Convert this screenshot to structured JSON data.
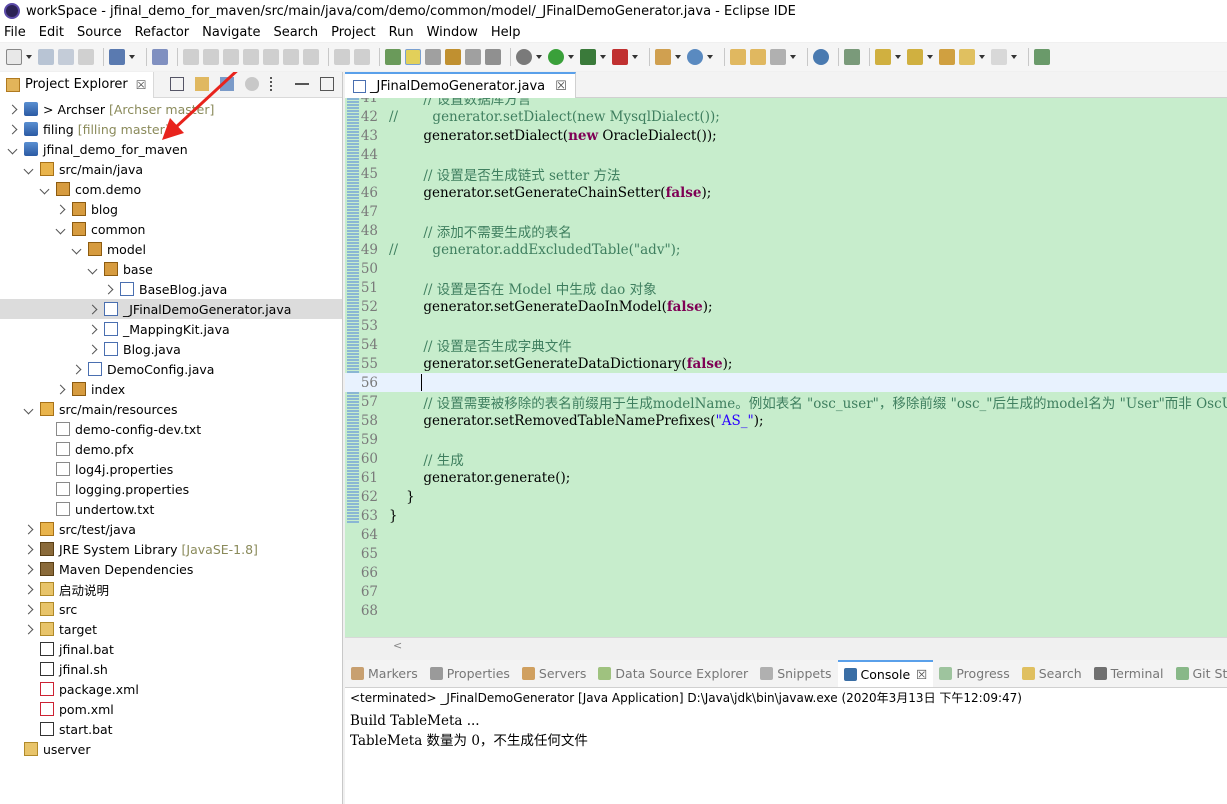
{
  "window": {
    "title": "workSpace - jfinal_demo_for_maven/src/main/java/com/demo/common/model/_JFinalDemoGenerator.java - Eclipse IDE"
  },
  "menu": [
    "File",
    "Edit",
    "Source",
    "Refactor",
    "Navigate",
    "Search",
    "Project",
    "Run",
    "Window",
    "Help"
  ],
  "explorer": {
    "tab_label": "Project Explorer",
    "close_glyph": "☒",
    "items": [
      {
        "label": "> Archser",
        "extra": "[Archser master]",
        "icon": "proj",
        "twisty": "closed",
        "depth": 0
      },
      {
        "label": "filing",
        "extra": "[filling master]",
        "icon": "proj",
        "twisty": "closed",
        "depth": 0
      },
      {
        "label": "jfinal_demo_for_maven",
        "extra": "",
        "icon": "proj",
        "twisty": "open",
        "depth": 0
      },
      {
        "label": "src/main/java",
        "extra": "",
        "icon": "pkgroot",
        "twisty": "open",
        "depth": 1
      },
      {
        "label": "com.demo",
        "extra": "",
        "icon": "pkg",
        "twisty": "open",
        "depth": 2
      },
      {
        "label": "blog",
        "extra": "",
        "icon": "pkg",
        "twisty": "closed",
        "depth": 3
      },
      {
        "label": "common",
        "extra": "",
        "icon": "pkg",
        "twisty": "open",
        "depth": 3
      },
      {
        "label": "model",
        "extra": "",
        "icon": "pkg",
        "twisty": "open",
        "depth": 4
      },
      {
        "label": "base",
        "extra": "",
        "icon": "pkg",
        "twisty": "open",
        "depth": 5
      },
      {
        "label": "BaseBlog.java",
        "extra": "",
        "icon": "java",
        "twisty": "closed",
        "depth": 6
      },
      {
        "label": "_JFinalDemoGenerator.java",
        "extra": "",
        "icon": "java",
        "twisty": "closed",
        "depth": 5,
        "selected": true
      },
      {
        "label": "_MappingKit.java",
        "extra": "",
        "icon": "java",
        "twisty": "closed",
        "depth": 5
      },
      {
        "label": "Blog.java",
        "extra": "",
        "icon": "java",
        "twisty": "closed",
        "depth": 5
      },
      {
        "label": "DemoConfig.java",
        "extra": "",
        "icon": "java",
        "twisty": "closed",
        "depth": 4
      },
      {
        "label": "index",
        "extra": "",
        "icon": "pkg",
        "twisty": "closed",
        "depth": 3
      },
      {
        "label": "src/main/resources",
        "extra": "",
        "icon": "pkgroot",
        "twisty": "open",
        "depth": 1
      },
      {
        "label": "demo-config-dev.txt",
        "extra": "",
        "icon": "file",
        "twisty": "none",
        "depth": 2
      },
      {
        "label": "demo.pfx",
        "extra": "",
        "icon": "file",
        "twisty": "none",
        "depth": 2
      },
      {
        "label": "log4j.properties",
        "extra": "",
        "icon": "file",
        "twisty": "none",
        "depth": 2
      },
      {
        "label": "logging.properties",
        "extra": "",
        "icon": "file",
        "twisty": "none",
        "depth": 2
      },
      {
        "label": "undertow.txt",
        "extra": "",
        "icon": "file",
        "twisty": "none",
        "depth": 2
      },
      {
        "label": "src/test/java",
        "extra": "",
        "icon": "pkgroot",
        "twisty": "closed",
        "depth": 1
      },
      {
        "label": "JRE System Library",
        "extra": "[JavaSE-1.8]",
        "icon": "lib",
        "twisty": "closed",
        "depth": 1
      },
      {
        "label": "Maven Dependencies",
        "extra": "",
        "icon": "lib",
        "twisty": "closed",
        "depth": 1
      },
      {
        "label": "启动说明",
        "extra": "",
        "icon": "folder",
        "twisty": "closed",
        "depth": 1
      },
      {
        "label": "src",
        "extra": "",
        "icon": "folder",
        "twisty": "closed",
        "depth": 1
      },
      {
        "label": "target",
        "extra": "",
        "icon": "folder",
        "twisty": "closed",
        "depth": 1
      },
      {
        "label": "jfinal.bat",
        "extra": "",
        "icon": "bat",
        "twisty": "none",
        "depth": 1
      },
      {
        "label": "jfinal.sh",
        "extra": "",
        "icon": "bat",
        "twisty": "none",
        "depth": 1
      },
      {
        "label": "package.xml",
        "extra": "",
        "icon": "xml",
        "twisty": "none",
        "depth": 1
      },
      {
        "label": "pom.xml",
        "extra": "",
        "icon": "xml",
        "twisty": "none",
        "depth": 1
      },
      {
        "label": "start.bat",
        "extra": "",
        "icon": "bat",
        "twisty": "none",
        "depth": 1
      },
      {
        "label": "userver",
        "extra": "",
        "icon": "folder",
        "twisty": "none",
        "depth": 0
      }
    ]
  },
  "editor": {
    "tab_label": "_JFinalDemoGenerator.java",
    "close_glyph": "☒",
    "lines": [
      {
        "n": "41",
        "t": "        // 设置数据库方言",
        "c": "cmt"
      },
      {
        "n": "42",
        "t": "//        generator.setDialect(new MysqlDialect());",
        "c": "cmt"
      },
      {
        "n": "43",
        "t": "        generator.setDialect(new OracleDialect());",
        "c": "code"
      },
      {
        "n": "44",
        "t": "",
        "c": "code"
      },
      {
        "n": "45",
        "t": "        // 设置是否生成链式 setter 方法",
        "c": "cmt"
      },
      {
        "n": "46",
        "t": "        generator.setGenerateChainSetter(false);",
        "c": "code"
      },
      {
        "n": "47",
        "t": "",
        "c": "code"
      },
      {
        "n": "48",
        "t": "        // 添加不需要生成的表名",
        "c": "cmt"
      },
      {
        "n": "49",
        "t": "//        generator.addExcludedTable(\"adv\");",
        "c": "cmt"
      },
      {
        "n": "50",
        "t": "",
        "c": "code"
      },
      {
        "n": "51",
        "t": "        // 设置是否在 Model 中生成 dao 对象",
        "c": "cmt"
      },
      {
        "n": "52",
        "t": "        generator.setGenerateDaoInModel(false);",
        "c": "code"
      },
      {
        "n": "53",
        "t": "",
        "c": "code"
      },
      {
        "n": "54",
        "t": "        // 设置是否生成字典文件",
        "c": "cmt"
      },
      {
        "n": "55",
        "t": "        generator.setGenerateDataDictionary(false);",
        "c": "code"
      },
      {
        "n": "56",
        "t": "",
        "c": "cur"
      },
      {
        "n": "57",
        "t": "        // 设置需要被移除的表名前缀用于生成modelName。例如表名 \"osc_user\"，移除前缀 \"osc_\"后生成的model名为 \"User\"而非 OscUser",
        "c": "cmt"
      },
      {
        "n": "58",
        "t": "        generator.setRemovedTableNamePrefixes(\"AS_\");",
        "c": "code"
      },
      {
        "n": "59",
        "t": "",
        "c": "code"
      },
      {
        "n": "60",
        "t": "        // 生成",
        "c": "cmt"
      },
      {
        "n": "61",
        "t": "        generator.generate();",
        "c": "code"
      },
      {
        "n": "62",
        "t": "    }",
        "c": "code"
      },
      {
        "n": "63",
        "t": "}",
        "c": "code"
      },
      {
        "n": "64",
        "t": "",
        "c": "code"
      },
      {
        "n": "65",
        "t": "",
        "c": "code"
      },
      {
        "n": "66",
        "t": "",
        "c": "code"
      },
      {
        "n": "67",
        "t": "",
        "c": "code"
      },
      {
        "n": "68",
        "t": "",
        "c": "code"
      }
    ],
    "hscroll_glyph": "<"
  },
  "console": {
    "tabs": [
      {
        "label": "Markers",
        "active": false,
        "color": "#c8a070"
      },
      {
        "label": "Properties",
        "active": false,
        "color": "#9a9a9a"
      },
      {
        "label": "Servers",
        "active": false,
        "color": "#d0a060"
      },
      {
        "label": "Data Source Explorer",
        "active": false,
        "color": "#9fc27f"
      },
      {
        "label": "Snippets",
        "active": false,
        "color": "#b0b0b0"
      },
      {
        "label": "Console",
        "active": true,
        "color": "#3a6ea5"
      },
      {
        "label": "Progress",
        "active": false,
        "color": "#9ec49e"
      },
      {
        "label": "Search",
        "active": false,
        "color": "#e0c060"
      },
      {
        "label": "Terminal",
        "active": false,
        "color": "#707070"
      },
      {
        "label": "Git Staging",
        "active": false,
        "color": "#88b888"
      }
    ],
    "close_glyph": "☒",
    "status": "<terminated> _JFinalDemoGenerator [Java Application] D:\\Java\\jdk\\bin\\javaw.exe (2020年3月13日 下午12:09:47)",
    "output": [
      "Build TableMeta ...",
      "TableMeta 数量为 0，不生成任何文件"
    ]
  }
}
